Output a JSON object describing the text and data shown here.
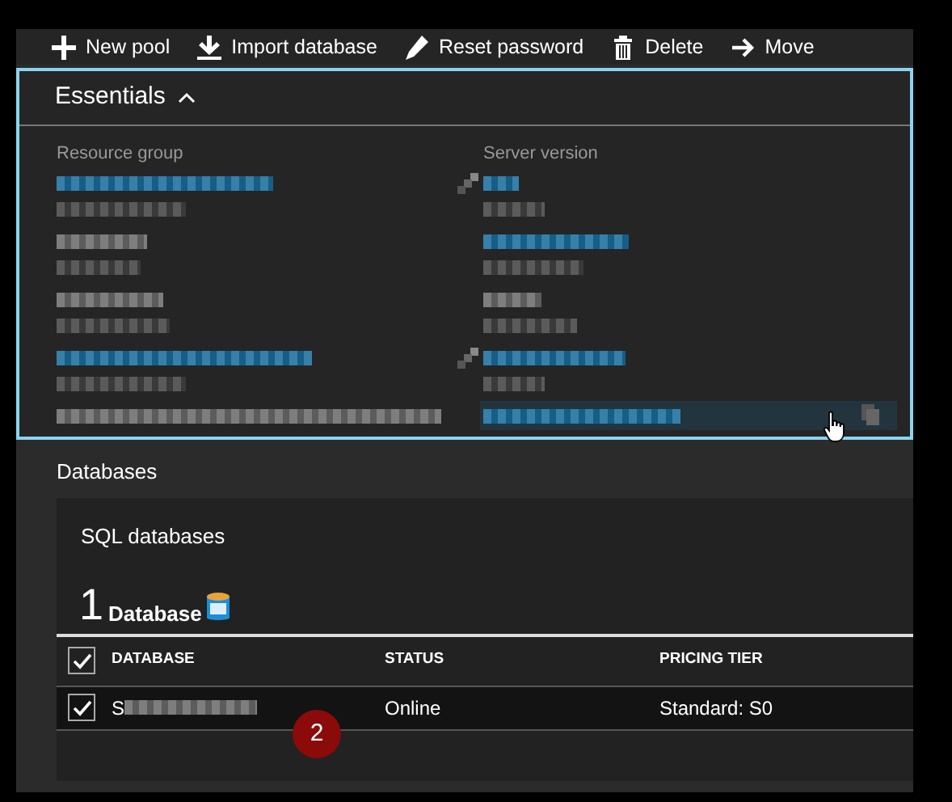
{
  "toolbar": [
    {
      "label": "New pool",
      "kind": "plus"
    },
    {
      "label": "Import database",
      "kind": "download"
    },
    {
      "label": "Reset password",
      "kind": "pencil"
    },
    {
      "label": "Delete",
      "kind": "trash"
    },
    {
      "label": "Move",
      "kind": "arrow"
    }
  ],
  "essentials": {
    "title": "Essentials",
    "expanded": true,
    "columns": [
      [
        {
          "label": "Resource group",
          "kind": "link",
          "pin": true
        },
        {
          "kind": "plain"
        },
        {
          "kind": "plain"
        },
        {
          "kind": "link",
          "pin": true
        },
        {
          "kind": "plain"
        }
      ],
      [
        {
          "label": "Server version",
          "kind": "link"
        },
        {
          "kind": "link"
        },
        {
          "kind": "plain"
        },
        {
          "kind": "link"
        },
        {
          "kind": "link",
          "hovered": true
        }
      ]
    ]
  },
  "databases": {
    "title": "Databases",
    "tile_title": "SQL databases",
    "count": "1",
    "count_label": "Database",
    "columns": [
      "DATABASE",
      "STATUS",
      "PRICING TIER"
    ],
    "all_checked": true,
    "rows": [
      {
        "name_initial": "S",
        "status": "Online",
        "tier": "Standard: S0",
        "checked": true,
        "selected": true
      }
    ]
  },
  "callout": {
    "label": "2"
  }
}
